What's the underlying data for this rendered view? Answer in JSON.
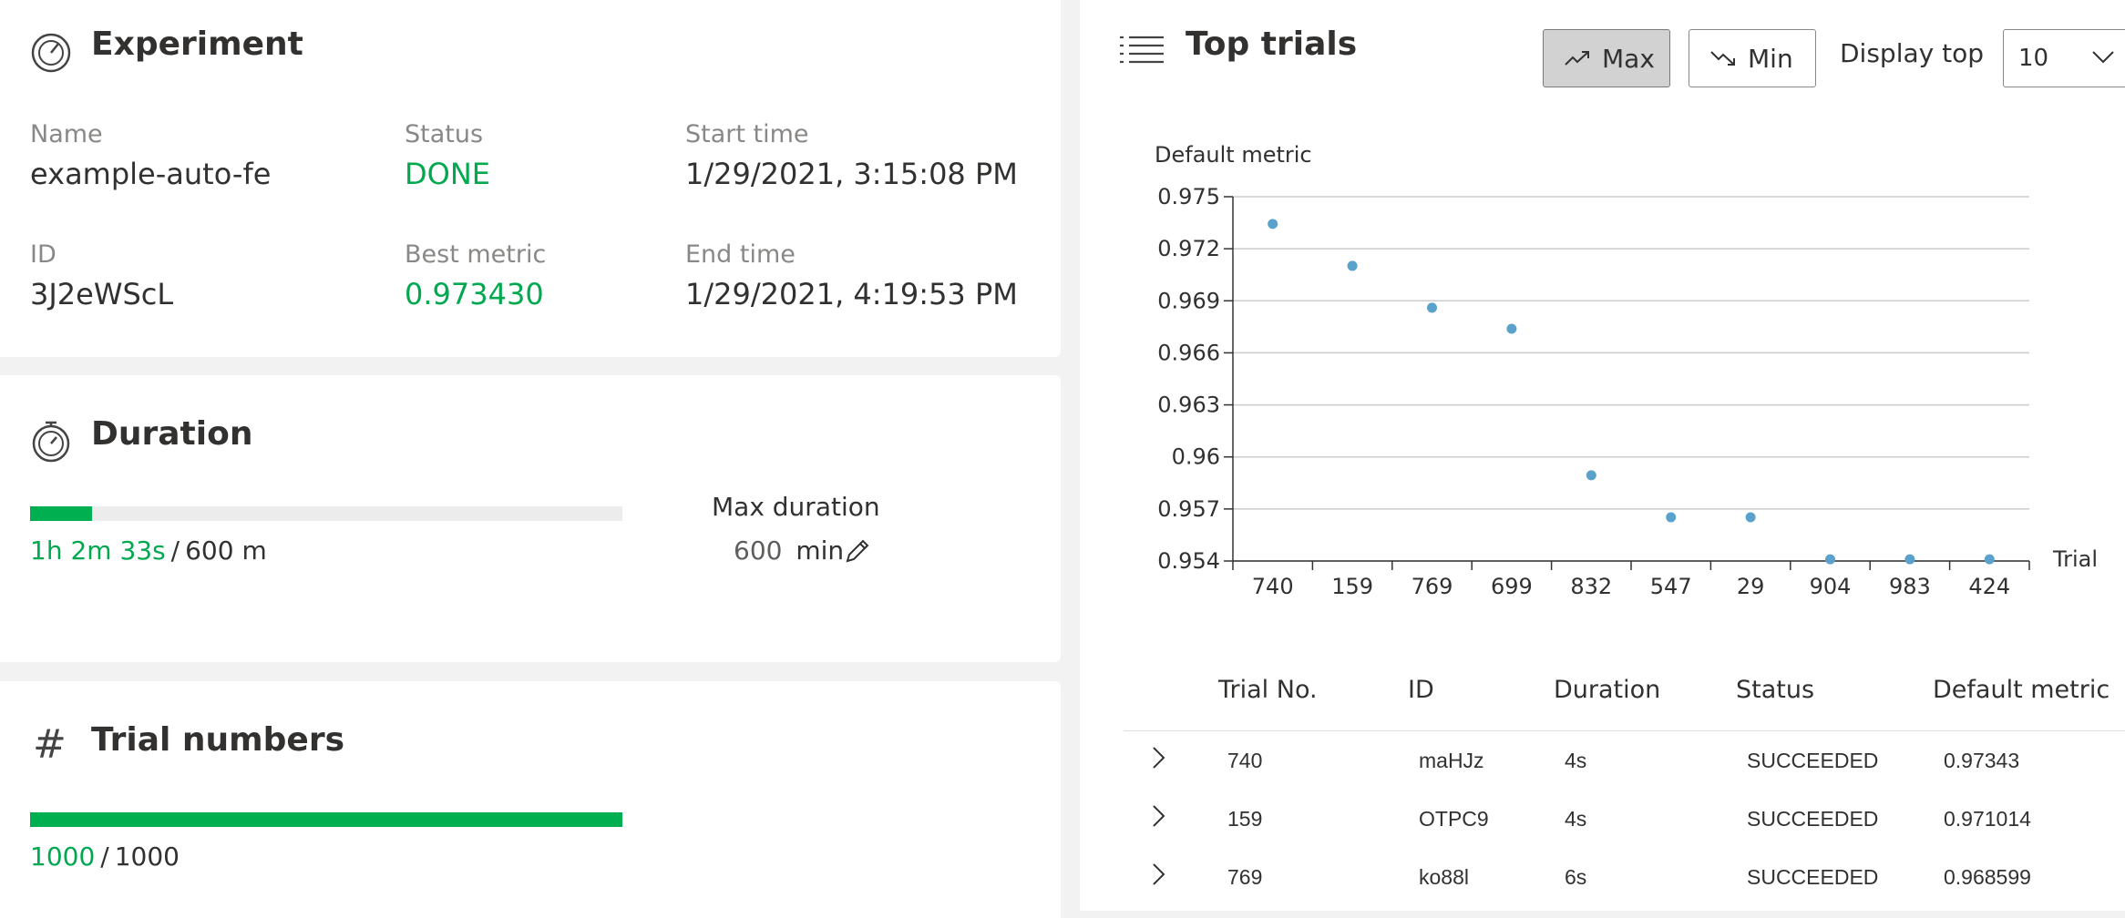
{
  "experiment": {
    "title": "Experiment",
    "name_label": "Name",
    "name_value": "example-auto-fe",
    "id_label": "ID",
    "id_value": "3J2eWScL",
    "status_label": "Status",
    "status_value": "DONE",
    "best_metric_label": "Best metric",
    "best_metric_value": "0.973430",
    "start_label": "Start time",
    "start_value": "1/29/2021, 3:15:08 PM",
    "end_label": "End time",
    "end_value": "1/29/2021, 4:19:53 PM"
  },
  "duration": {
    "title": "Duration",
    "elapsed": "1h 2m 33s",
    "separator": "/",
    "total": "600 m",
    "progress_fraction": 0.104,
    "max_label": "Max duration",
    "max_value": "600",
    "max_unit": "min"
  },
  "trials": {
    "title": "Trial numbers",
    "done": "1000",
    "separator": "/",
    "total": "1000",
    "progress_fraction": 1.0
  },
  "top_trials": {
    "title": "Top trials",
    "max_label": "Max",
    "min_label": "Min",
    "display_top_label": "Display top",
    "display_top_value": "10",
    "columns": [
      "Trial No.",
      "ID",
      "Duration",
      "Status",
      "Default metric"
    ],
    "rows": [
      {
        "trial": "740",
        "id": "maHJz",
        "duration": "4s",
        "status": "SUCCEEDED",
        "metric": "0.97343"
      },
      {
        "trial": "159",
        "id": "OTPC9",
        "duration": "4s",
        "status": "SUCCEEDED",
        "metric": "0.971014"
      },
      {
        "trial": "769",
        "id": "ko88l",
        "duration": "6s",
        "status": "SUCCEEDED",
        "metric": "0.968599"
      }
    ]
  },
  "colors": {
    "accent_green": "#00a950",
    "point_blue": "#5aa2cb"
  },
  "chart_data": {
    "type": "scatter",
    "ylabel": "Default metric",
    "xlabel": "Trial",
    "categories": [
      "740",
      "159",
      "769",
      "699",
      "832",
      "547",
      "29",
      "904",
      "983",
      "424"
    ],
    "values": [
      0.97343,
      0.971014,
      0.968599,
      0.96739,
      0.95894,
      0.95652,
      0.95652,
      0.9541,
      0.9541,
      0.9541
    ],
    "ylim": [
      0.954,
      0.975
    ],
    "yticks": [
      "0.975",
      "0.972",
      "0.969",
      "0.966",
      "0.963",
      "0.96",
      "0.957",
      "0.954"
    ],
    "grid": true
  }
}
